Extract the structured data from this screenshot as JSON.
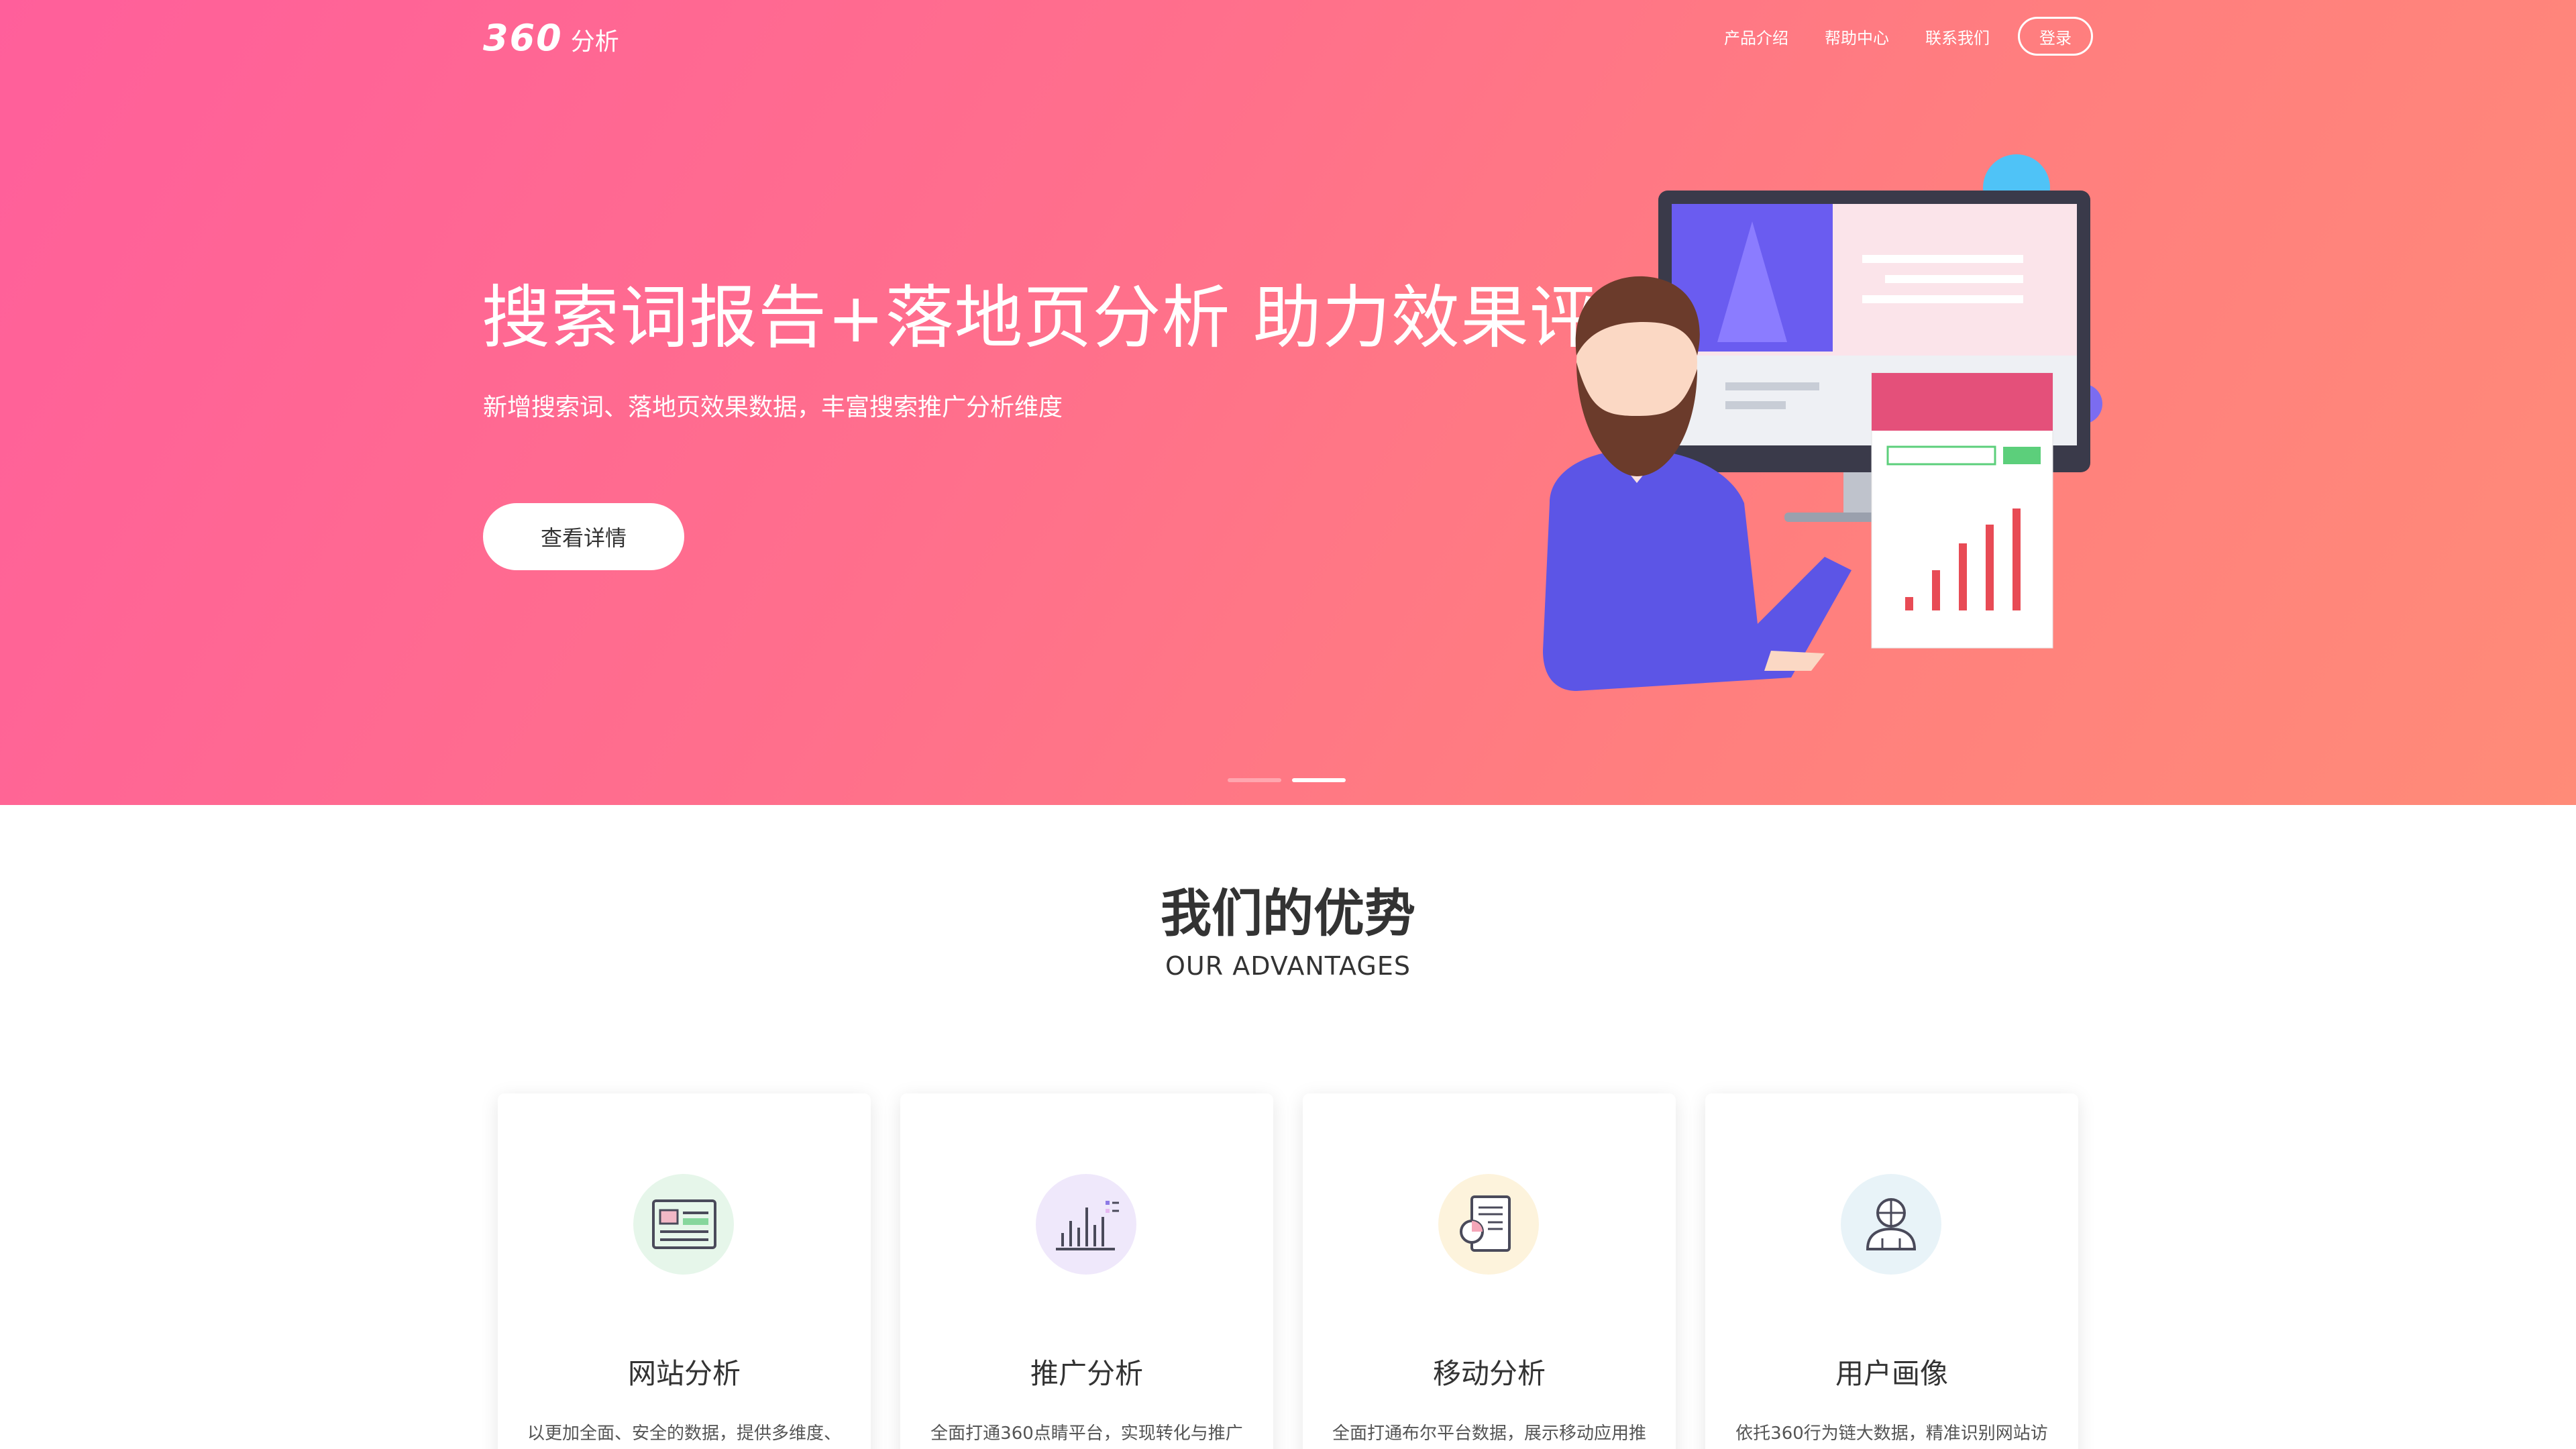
{
  "nav": {
    "logo_mark": "360",
    "logo_text": "分析",
    "links": [
      "产品介绍",
      "帮助中心",
      "联系我们"
    ],
    "login": "登录"
  },
  "hero": {
    "title": "搜索词报告+落地页分析 助力效果评估",
    "subtitle": "新增搜索词、落地页效果数据，丰富搜索推广分析维度",
    "button": "查看详情",
    "carousel_active_index": 1,
    "carousel_count": 2
  },
  "advantages": {
    "title": "我们的优势",
    "subtitle": "OUR ADVANTAGES",
    "cards": [
      {
        "title": "网站分析",
        "desc": "以更加全面、安全的数据，提供多维度、",
        "icon": "website-analytics-icon",
        "color": "#e6f6ea"
      },
      {
        "title": "推广分析",
        "desc": "全面打通360点睛平台，实现转化与推广",
        "icon": "promotion-chart-icon",
        "color": "#efe8fb"
      },
      {
        "title": "移动分析",
        "desc": "全面打通布尔平台数据，展示移动应用推",
        "icon": "mobile-report-icon",
        "color": "#fdf3dc"
      },
      {
        "title": "用户画像",
        "desc": "依托360行为链大数据，精准识别网站访",
        "icon": "user-profile-icon",
        "color": "#e8f3f8"
      }
    ]
  },
  "colors": {
    "hero_gradient_start": "#ff5f9b",
    "hero_gradient_end": "#ff8b78",
    "text_dark": "#333333"
  }
}
